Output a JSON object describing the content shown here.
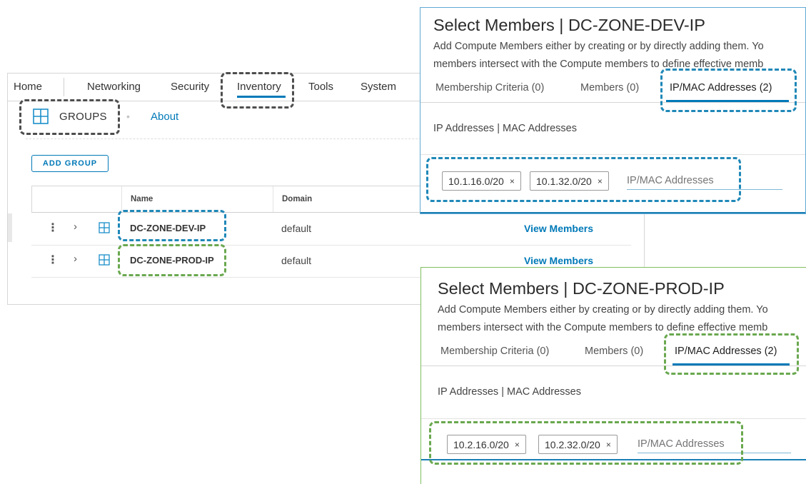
{
  "nav": {
    "items": [
      "Home",
      "Networking",
      "Security",
      "Inventory",
      "Tools",
      "System"
    ],
    "active": "Inventory"
  },
  "subnav": {
    "groups_label": "GROUPS",
    "about_label": "About",
    "separator": "•"
  },
  "toolbar": {
    "add_group_label": "ADD GROUP"
  },
  "table": {
    "columns": [
      "Name",
      "Domain"
    ],
    "rows": [
      {
        "name": "DC-ZONE-DEV-IP",
        "domain": "default",
        "action": "View Members"
      },
      {
        "name": "DC-ZONE-PROD-IP",
        "domain": "default",
        "action": "View Members"
      }
    ]
  },
  "dev_panel": {
    "title": "Select Members | DC-ZONE-DEV-IP",
    "desc_line1": "Add Compute Members either by creating or by directly adding them. Yo",
    "desc_line2": "members intersect with the Compute members to define effective memb",
    "tabs": [
      "Membership Criteria (0)",
      "Members (0)",
      "IP/MAC Addresses (2)"
    ],
    "section_label": "IP Addresses | MAC Addresses",
    "chips": [
      "10.1.16.0/20",
      "10.1.32.0/20"
    ],
    "input_placeholder": "IP/MAC Addresses"
  },
  "prod_panel": {
    "title": "Select Members | DC-ZONE-PROD-IP",
    "desc_line1": "Add Compute Members either by creating or by directly adding them. Yo",
    "desc_line2": "members intersect with the Compute members to define effective memb",
    "tabs": [
      "Membership Criteria (0)",
      "Members (0)",
      "IP/MAC Addresses (2)"
    ],
    "section_label": "IP Addresses | MAC Addresses",
    "chips": [
      "10.2.16.0/20",
      "10.2.32.0/20"
    ],
    "input_placeholder": "IP/MAC Addresses"
  },
  "chip_remove_glyph": "×",
  "row_glyphs": {
    "kebab": "⋮",
    "expand": "›"
  },
  "colors": {
    "accent": "#0079b8",
    "callout_gray": "#4e4e4e",
    "callout_blue": "#1f88b8",
    "callout_green": "#6aa84f"
  }
}
